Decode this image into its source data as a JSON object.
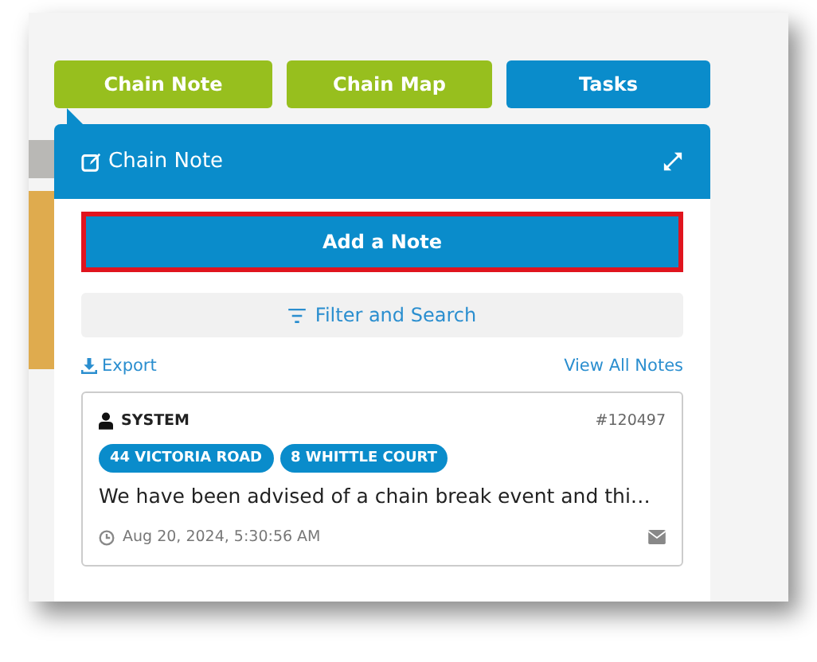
{
  "tabs": [
    {
      "label": "Chain Note",
      "color": "#97bf1e",
      "selected": true
    },
    {
      "label": "Chain Map",
      "color": "#97bf1e",
      "selected": false
    },
    {
      "label": "Tasks",
      "color": "#0a8ccb",
      "selected": false
    }
  ],
  "panel": {
    "title": "Chain Note",
    "add_button": "Add a Note",
    "filter_button": "Filter and Search",
    "export_link": "Export",
    "view_all_link": "View All Notes",
    "notes": [
      {
        "author": "SYSTEM",
        "number": "#120497",
        "tags": [
          "44 VICTORIA ROAD",
          "8 WHITTLE COURT"
        ],
        "text": "We have been advised of a chain break event and thi…",
        "time": "Aug 20, 2024, 5:30:56 AM"
      }
    ]
  }
}
